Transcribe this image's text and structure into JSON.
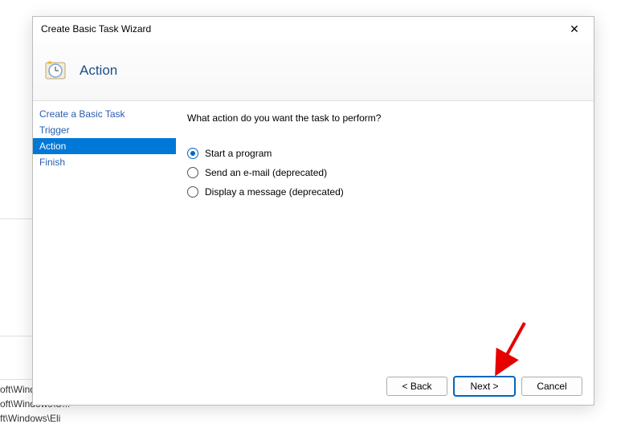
{
  "bgPaths": {
    "p1": "oft\\Wind",
    "p2": "oft\\Windows\\U...",
    "p3": "ft\\Windows\\Eli"
  },
  "dialog": {
    "title": "Create Basic Task Wizard",
    "header": "Action",
    "closeGlyph": "✕"
  },
  "sidebar": {
    "items": [
      {
        "label": "Create a Basic Task",
        "active": false
      },
      {
        "label": "Trigger",
        "active": false
      },
      {
        "label": "Action",
        "active": true
      },
      {
        "label": "Finish",
        "active": false
      }
    ]
  },
  "content": {
    "prompt": "What action do you want the task to perform?",
    "options": [
      {
        "label": "Start a program",
        "checked": true
      },
      {
        "label": "Send an e-mail (deprecated)",
        "checked": false
      },
      {
        "label": "Display a message (deprecated)",
        "checked": false
      }
    ]
  },
  "footer": {
    "back": "< Back",
    "next": "Next >",
    "cancel": "Cancel"
  }
}
